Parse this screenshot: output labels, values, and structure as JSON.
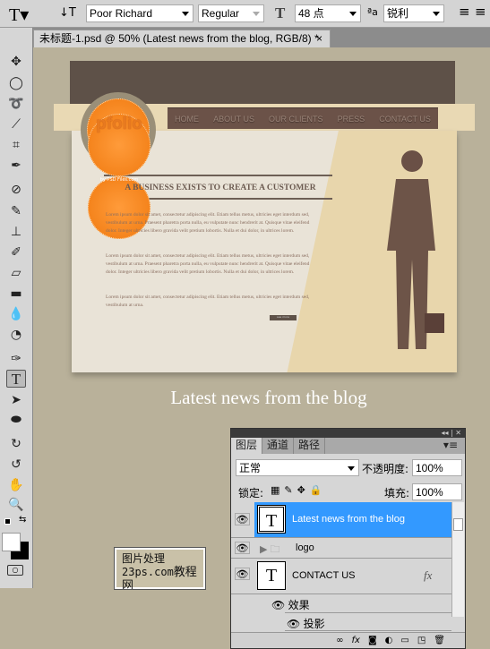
{
  "options_bar": {
    "tool_icon": "type-tool-icon",
    "font_family": "Poor Richard",
    "font_style": "Regular",
    "font_size": "48 点",
    "antialias": "锐利"
  },
  "document_tab": {
    "title": "未标题-1.psd @ 50% (Latest news from the blog, RGB/8) *",
    "close": "×"
  },
  "toolbox": {
    "tools": [
      "move",
      "marquee",
      "lasso",
      "quick-select",
      "crop",
      "eyedropper",
      "healing",
      "brush",
      "stamp",
      "history-brush",
      "eraser",
      "gradient",
      "blur",
      "dodge",
      "pen",
      "type",
      "path-select",
      "shape",
      "3d-rotate",
      "3d-orbit",
      "hand",
      "zoom"
    ],
    "active": "type"
  },
  "mockup": {
    "logo": {
      "name": "pfolio",
      "tagline": "by PSD Files.com"
    },
    "nav": [
      "HOME",
      "ABOUT US",
      "OUR CLIENTS",
      "PRESS",
      "CONTACT US"
    ],
    "headline": "A BUSINESS EXISTS TO CREATE A CUSTOMER",
    "paragraphs": [
      "Lorem ipsum dolor sit amet, consectetur adipiscing elit. Etiam tellus metus, ultricies eget interdum sed, vestibulum at urna. Praesent pharetra porta nulla, eu vulputate nunc hendrerit at. Quisque vitae eleifend dolor. Integer ultricies libero gravida velit pretium lobortis. Nulla et dui dolor, in ultrices lorem.",
      "Lorem ipsum dolor sit amet, consectetur adipiscing elit. Etiam tellus metus, ultricies eget interdum sed, vestibulum at urna. Praesent pharetra porta nulla, eu vulputate nunc hendrerit at. Quisque vitae eleifend dolor. Integer ultricies libero gravida velit pretium lobortis. Nulla et dui dolor, in ultrices lorem.",
      "Lorem ipsum dolor sit amet, consectetur adipiscing elit. Etiam tellus metus, ultricies eget interdum sed, vestibulum at urna."
    ],
    "more_button": "see more",
    "caption": "Latest news from the blog"
  },
  "watermark": {
    "line1": "图片处理",
    "line2": "23ps.com",
    "line3": "教程网"
  },
  "layers_panel": {
    "tabs": [
      "图层",
      "通道",
      "路径"
    ],
    "blend_mode": "正常",
    "opacity_label": "不透明度:",
    "opacity": "100%",
    "lock_label": "锁定:",
    "fill_label": "填充:",
    "fill": "100%",
    "layers": [
      {
        "name": "Latest news from the blog",
        "type": "text",
        "selected": true
      },
      {
        "name": "logo",
        "type": "group"
      },
      {
        "name": "CONTACT US",
        "type": "text",
        "fx": "fx"
      }
    ],
    "effects_label": "效果",
    "effect": "投影",
    "selected_color": "#3399ff"
  }
}
